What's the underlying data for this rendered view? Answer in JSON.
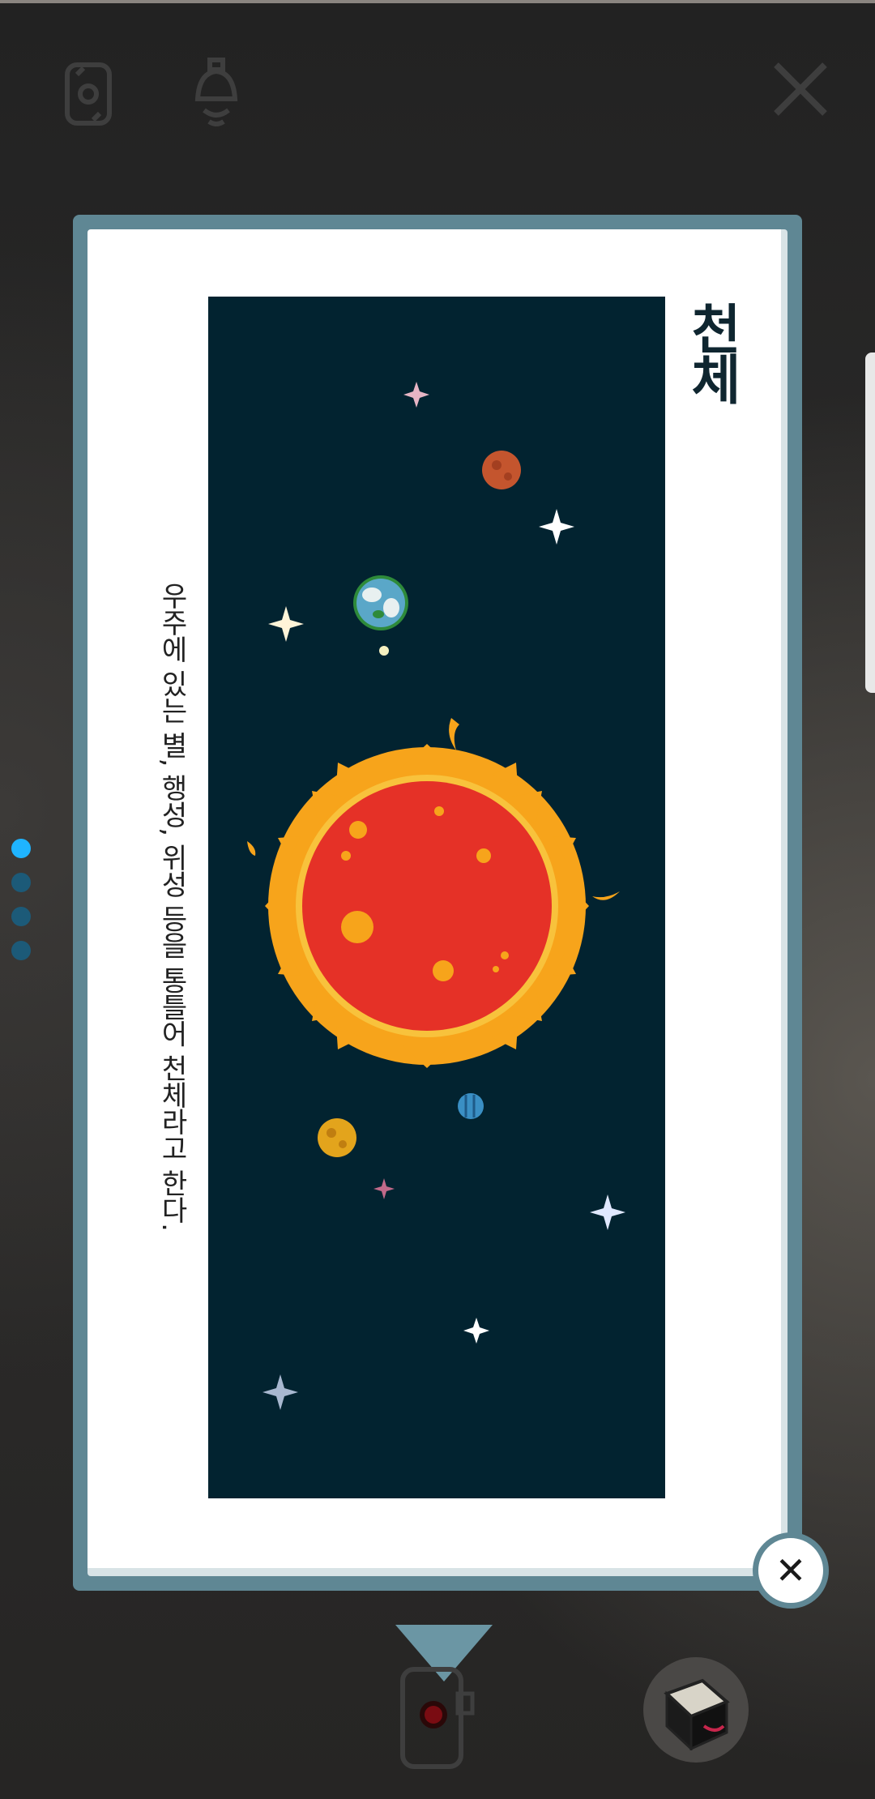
{
  "toolbar": {
    "icons": [
      "camera-switch-icon",
      "bell-icon",
      "close-icon"
    ]
  },
  "pager": {
    "count": 4,
    "active_index": 0
  },
  "card": {
    "title": "천체",
    "description": "우주에 있는 별, 행성, 위성 등을 통틀어 천체라고 한다.",
    "illustration": "solar-system-illustration",
    "close_icon": "✕"
  },
  "bottom_bar": {
    "icons": [
      "collapse-triangle-icon",
      "record-icon",
      "book-icon"
    ]
  },
  "colors": {
    "accent_frame": "#5f8794",
    "space_background": "#022330",
    "active_dot": "#1fb4ff",
    "inactive_dot": "#1c5a78"
  }
}
